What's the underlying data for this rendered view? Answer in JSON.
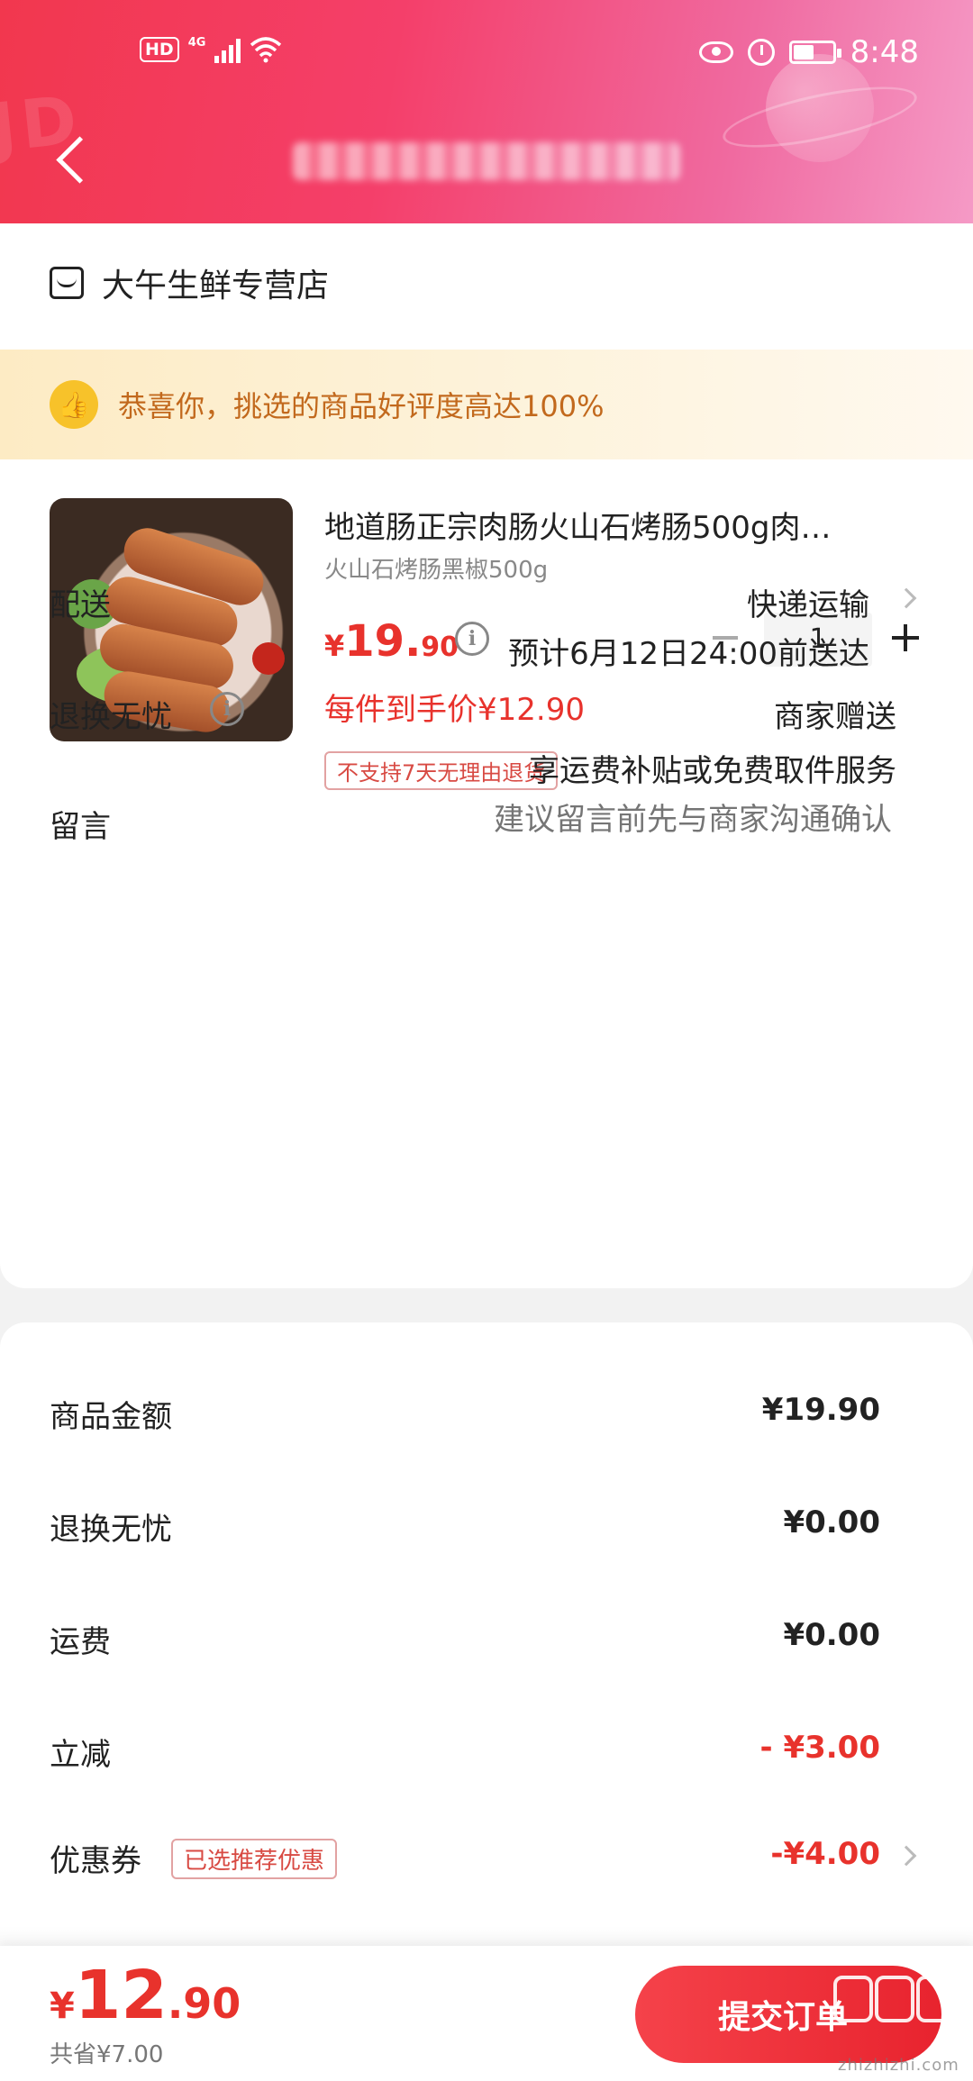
{
  "status_bar": {
    "hd": "HD",
    "network": "4G",
    "time": "8:48"
  },
  "shop": {
    "name": "大午生鲜专营店"
  },
  "banner": {
    "text": "恭喜你，挑选的商品好评度高达100%"
  },
  "product": {
    "title": "地道肠正宗肉肠火山石烤肠500g肉…",
    "spec": "火山石烤肠黑椒500g",
    "price_yen": "¥",
    "price_int": "19.",
    "price_dec": "90",
    "quantity": "1",
    "final_price": "每件到手价¥12.90",
    "return_tag": "不支持7天无理由退货"
  },
  "delivery": {
    "label": "配送",
    "method": "快递运输",
    "eta": "预计6月12日24:00前送达"
  },
  "return_service": {
    "label": "退换无忧",
    "value": "商家赠送",
    "desc": "享运费补贴或免费取件服务"
  },
  "message": {
    "label": "留言",
    "placeholder": "建议留言前先与商家沟通确认"
  },
  "summary": {
    "goods_label": "商品金额",
    "goods_value": "¥19.90",
    "return_label": "退换无忧",
    "return_value": "¥0.00",
    "shipping_label": "运费",
    "shipping_value": "¥0.00",
    "discount_label": "立减",
    "discount_value": "- ¥3.00",
    "coupon_label": "优惠券",
    "coupon_tag": "已选推荐优惠",
    "coupon_value": "-¥4.00"
  },
  "footer": {
    "total_yen": "¥",
    "total_int": "12",
    "total_dec": ".90",
    "saved": "共省¥7.00",
    "submit_label": "提交订单",
    "watermark": "zhizhizhi.com"
  },
  "colors": {
    "accent": "#e8322c",
    "header_start": "#f2374e",
    "header_end": "#f59ac6",
    "banner_text": "#c2691d"
  },
  "icons": [
    "back-icon",
    "store-icon",
    "thumbs-up-icon",
    "info-icon",
    "minus-icon",
    "plus-icon",
    "chevron-right-icon"
  ]
}
